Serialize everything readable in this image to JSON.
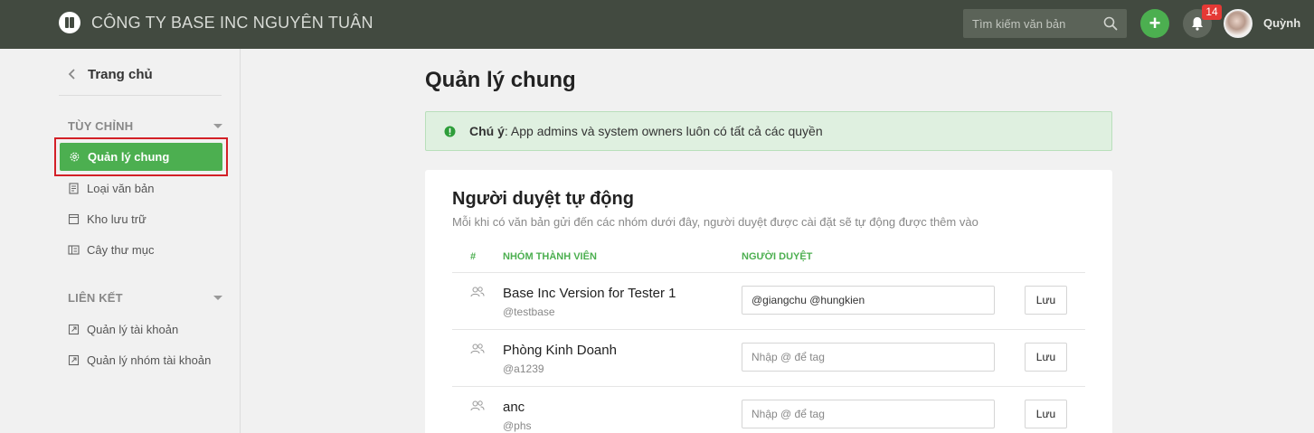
{
  "header": {
    "company": "CÔNG TY BASE INC NGUYÊN TUÂN",
    "search_placeholder": "Tìm kiếm văn bản",
    "notification_count": "14",
    "user_name": "Quỳnh"
  },
  "sidebar": {
    "back_label": "Trang chủ",
    "section_custom": "TÙY CHỈNH",
    "custom_items": [
      {
        "label": "Quản lý chung",
        "icon": "gear-icon",
        "active": true
      },
      {
        "label": "Loại văn bản",
        "icon": "document-icon"
      },
      {
        "label": "Kho lưu trữ",
        "icon": "archive-icon"
      },
      {
        "label": "Cây thư mục",
        "icon": "folder-tree-icon"
      }
    ],
    "section_links": "LIÊN KẾT",
    "link_items": [
      {
        "label": "Quản lý tài khoản",
        "icon": "external-link-icon"
      },
      {
        "label": "Quản lý nhóm tài khoản",
        "icon": "external-link-icon"
      }
    ]
  },
  "main": {
    "title": "Quản lý chung",
    "alert": {
      "strong": "Chú ý",
      "text": ": App admins và system owners luôn có tất cả các quyền"
    },
    "card": {
      "title": "Người duyệt tự động",
      "description": "Mỗi khi có văn bản gửi đến các nhóm dưới đây, người duyệt được cài đặt sẽ tự động được thêm vào",
      "columns": {
        "index": "#",
        "group": "NHÓM THÀNH VIÊN",
        "approver": "NGƯỜI DUYỆT"
      },
      "input_placeholder": "Nhập @ để tag",
      "save_label": "Lưu",
      "rows": [
        {
          "name": "Base Inc Version for Tester 1",
          "handle": "@testbase",
          "approvers": "@giangchu @hungkien"
        },
        {
          "name": "Phòng Kinh Doanh",
          "handle": "@a1239",
          "approvers": ""
        },
        {
          "name": "anc",
          "handle": "@phs",
          "approvers": ""
        }
      ]
    }
  },
  "colors": {
    "topbar": "#424a40",
    "accent": "#4caf50",
    "highlight_border": "#d32027",
    "alert_bg": "#dff0e0"
  }
}
